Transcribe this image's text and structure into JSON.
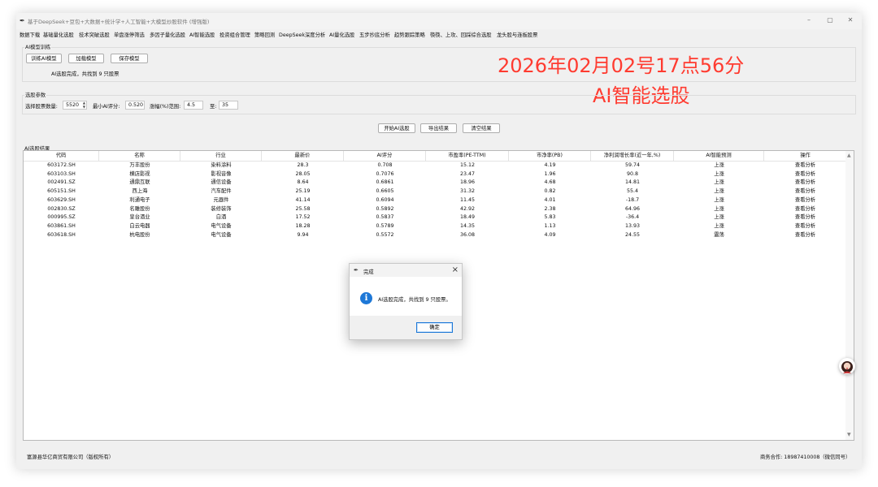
{
  "window": {
    "title": "基于DeepSeek+豆包+大数据+统计学+人工智能+大模型炒股软件 (增强版)",
    "controls": [
      "–",
      "▢",
      "✕"
    ]
  },
  "menu": [
    "数据下载",
    "基础量化选股",
    "技术突破选股",
    "单盘涨停筛选",
    "多因子量化选股",
    "AI智能选股",
    "投资组合管理",
    "策略回测",
    "DeepSeek深度分析",
    "AI量化选股",
    "五步抄底分析",
    "趋势跟踪策略",
    "筷筷、上攻、回踩综合选股",
    "龙头股与连板股票"
  ],
  "ai_training": {
    "title": "AI模型训练",
    "buttons": [
      "训练AI模型",
      "加载模型",
      "保存模型"
    ],
    "status": "AI选股完成，共找到 9 只股票"
  },
  "overlay": {
    "datetime": "2026年02月02号17点56分",
    "subtitle": "AI智能选股"
  },
  "params": {
    "title": "选股参数",
    "count_label": "选择股票数量:",
    "count_value": "5520",
    "min_score_label": "最小AI评分:",
    "min_score_value": "0.520",
    "range_label": "涨幅(%)范围:",
    "range_min": "4.5",
    "range_to": "至:",
    "range_max": "35"
  },
  "actions": [
    "开始AI选股",
    "导出结果",
    "清空结果"
  ],
  "results": {
    "title": "AI选股结果",
    "columns": [
      "代码",
      "名称",
      "行业",
      "最新价",
      "AI评分",
      "市盈率(PE-TTM)",
      "市净率(PB)",
      "净利润增长率(近一年,%)",
      "AI智能预测",
      "操作"
    ],
    "rows": [
      [
        "603172.SH",
        "万丰股份",
        "染料涂料",
        "28.3",
        "0.708",
        "15.12",
        "4.19",
        "59.74",
        "上涨",
        "查看分析"
      ],
      [
        "603103.SH",
        "横店影视",
        "影视音像",
        "28.05",
        "0.7076",
        "23.47",
        "1.96",
        "90.8",
        "上涨",
        "查看分析"
      ],
      [
        "002491.SZ",
        "通鼎互联",
        "通信设备",
        "8.64",
        "0.6861",
        "18.96",
        "4.68",
        "14.81",
        "上涨",
        "查看分析"
      ],
      [
        "605151.SH",
        "西上海",
        "汽车配件",
        "25.19",
        "0.6605",
        "31.32",
        "0.82",
        "55.4",
        "上涨",
        "查看分析"
      ],
      [
        "603629.SH",
        "利通电子",
        "元器件",
        "41.14",
        "0.6094",
        "11.45",
        "4.01",
        "-18.7",
        "上涨",
        "查看分析"
      ],
      [
        "002830.SZ",
        "名雕股份",
        "装修装饰",
        "25.58",
        "0.5892",
        "42.92",
        "2.38",
        "64.96",
        "上涨",
        "查看分析"
      ],
      [
        "000995.SZ",
        "皇台酒业",
        "白酒",
        "17.52",
        "0.5837",
        "18.49",
        "5.83",
        "-36.4",
        "上涨",
        "查看分析"
      ],
      [
        "603861.SH",
        "白云电器",
        "电气设备",
        "18.28",
        "0.5789",
        "14.35",
        "1.13",
        "13.93",
        "上涨",
        "查看分析"
      ],
      [
        "603618.SH",
        "杭电股份",
        "电气设备",
        "9.94",
        "0.5572",
        "36.08",
        "4.09",
        "24.55",
        "震荡",
        "查看分析"
      ]
    ]
  },
  "dialog": {
    "title": "完成",
    "message": "AI选股完成，共找到 9 只股票。",
    "ok": "确定"
  },
  "footer": {
    "left": "富源县华亿商贸有限公司（版权所有）",
    "right": "商务合作: 18987410008（微信同号）"
  },
  "colors": {
    "overlay_red": "#ff3b30",
    "info_blue": "#1e78d7"
  },
  "icons": {
    "app": "feather-icon",
    "info": "info-icon",
    "avatar": "avatar-icon"
  }
}
